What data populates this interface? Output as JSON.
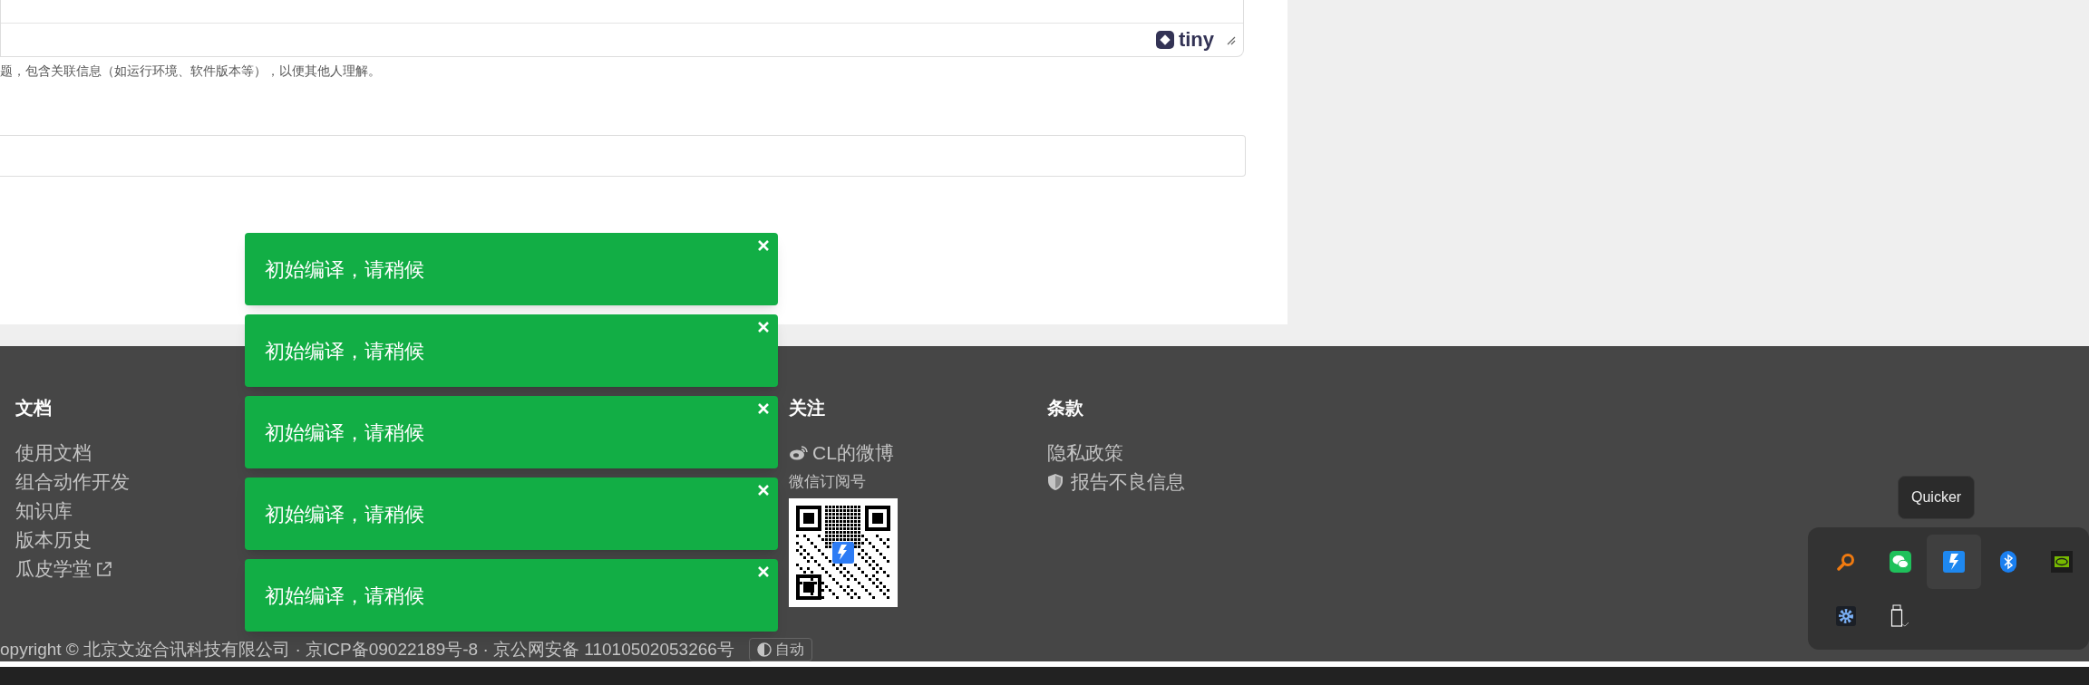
{
  "editor": {
    "brand": "tiny"
  },
  "hint": "题，包含关联信息（如运行环境、软件版本等），以便其他人理解。",
  "footer": {
    "columns": [
      {
        "heading": "文档",
        "links": [
          {
            "label": "使用文档",
            "external": false
          },
          {
            "label": "组合动作开发",
            "external": false
          },
          {
            "label": "知识库",
            "external": false
          },
          {
            "label": "版本历史",
            "external": false
          },
          {
            "label": "瓜皮学堂",
            "external": true
          }
        ]
      },
      {
        "heading": "关注",
        "weibo": "CL的微博",
        "wechat_label": "微信订阅号"
      },
      {
        "heading": "条款",
        "links": [
          {
            "label": "隐私政策",
            "shield": false
          },
          {
            "label": "报告不良信息",
            "shield": true
          }
        ]
      }
    ],
    "copyright": "opyright © 北京文迩合讯科技有限公司 · 京ICP备09022189号-8 · 京公网安备 11010502053266号",
    "theme_button": "自动"
  },
  "toasts": [
    {
      "message": "初始编译，请稍候"
    },
    {
      "message": "初始编译，请稍候"
    },
    {
      "message": "初始编译，请稍候"
    },
    {
      "message": "初始编译，请稍候"
    },
    {
      "message": "初始编译，请稍候"
    }
  ],
  "tray": {
    "tooltip": "Quicker",
    "icons": [
      {
        "kind": "search",
        "selected": false
      },
      {
        "kind": "chat",
        "selected": false
      },
      {
        "kind": "bolt",
        "selected": true
      },
      {
        "kind": "bluetooth",
        "selected": false
      },
      {
        "kind": "eye",
        "selected": false
      },
      {
        "kind": "gear",
        "selected": false
      },
      {
        "kind": "usb",
        "selected": false
      }
    ]
  }
}
